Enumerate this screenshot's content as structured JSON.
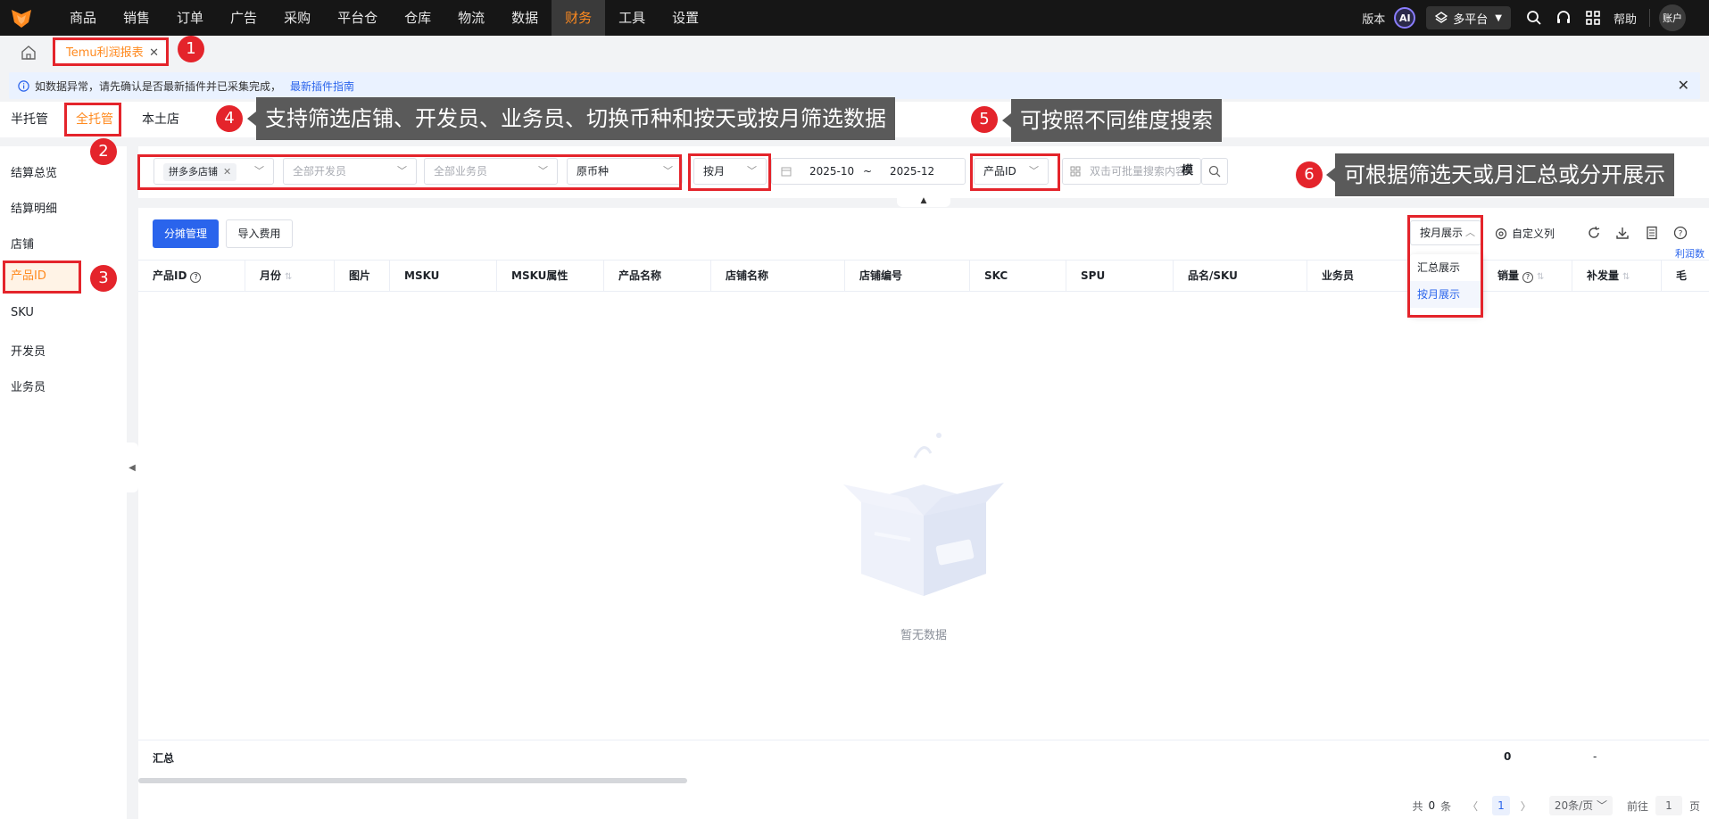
{
  "topnav": {
    "items": [
      "商品",
      "销售",
      "订单",
      "广告",
      "采购",
      "平台仓",
      "仓库",
      "物流",
      "数据",
      "财务",
      "工具",
      "设置"
    ],
    "active": "财务",
    "version": "版本",
    "ai": "AI",
    "platform": "多平台",
    "help": "帮助",
    "account": "账户"
  },
  "tabs": {
    "current": "Temu利润报表"
  },
  "notice": {
    "text": "如数据异常，请先确认是否最新插件并已采集完成，",
    "link": "最新插件指南"
  },
  "subtabs": [
    "半托管",
    "全托管",
    "本土店"
  ],
  "left_menu": [
    "结算总览",
    "结算明细",
    "店铺",
    "产品ID",
    "SKU",
    "开发员",
    "业务员"
  ],
  "filters": {
    "shop_tag": "拼多多店铺",
    "developer_placeholder": "全部开发员",
    "salesman_placeholder": "全部业务员",
    "currency": "原币种",
    "period": "按月",
    "date_from": "2025-10",
    "date_sep": "~",
    "date_to": "2025-12",
    "dimension": "产品ID",
    "search_placeholder": "双击可批量搜索内容",
    "mode": "模"
  },
  "toolbar": {
    "allocate": "分摊管理",
    "import_fee": "导入费用",
    "display_mode": "按月展示",
    "custom_cols": "自定义列",
    "profit_link": "利润数"
  },
  "display_options": [
    "汇总展示",
    "按月展示"
  ],
  "table": {
    "headers": [
      "产品ID",
      "月份",
      "图片",
      "MSKU",
      "MSKU属性",
      "产品名称",
      "店铺名称",
      "店铺编号",
      "SKC",
      "SPU",
      "品名/SKU",
      "业务员",
      "",
      "销量",
      "补发量",
      "毛"
    ]
  },
  "empty_text": "暂无数据",
  "summary": {
    "label": "汇总",
    "sales": "0",
    "reship": "-"
  },
  "pagination": {
    "total_prefix": "共",
    "total": "0",
    "total_suffix": "条",
    "current": "1",
    "page_size": "20条/页",
    "goto": "前往",
    "goto_value": "1",
    "page_suffix": "页"
  },
  "annotations": {
    "n1": "1",
    "n2": "2",
    "n3": "3",
    "n4": "4",
    "n5": "5",
    "n6": "6",
    "tip4": "支持筛选店铺、开发员、业务员、切换币种和按天或按月筛选数据",
    "tip5": "可按照不同维度搜索",
    "tip6": "可根据筛选天或月汇总或分开展示"
  },
  "colors": {
    "accent": "#ff8a1f",
    "primary": "#2a64ec",
    "annotation_red": "#e4242b",
    "nav_bg": "#161616"
  }
}
